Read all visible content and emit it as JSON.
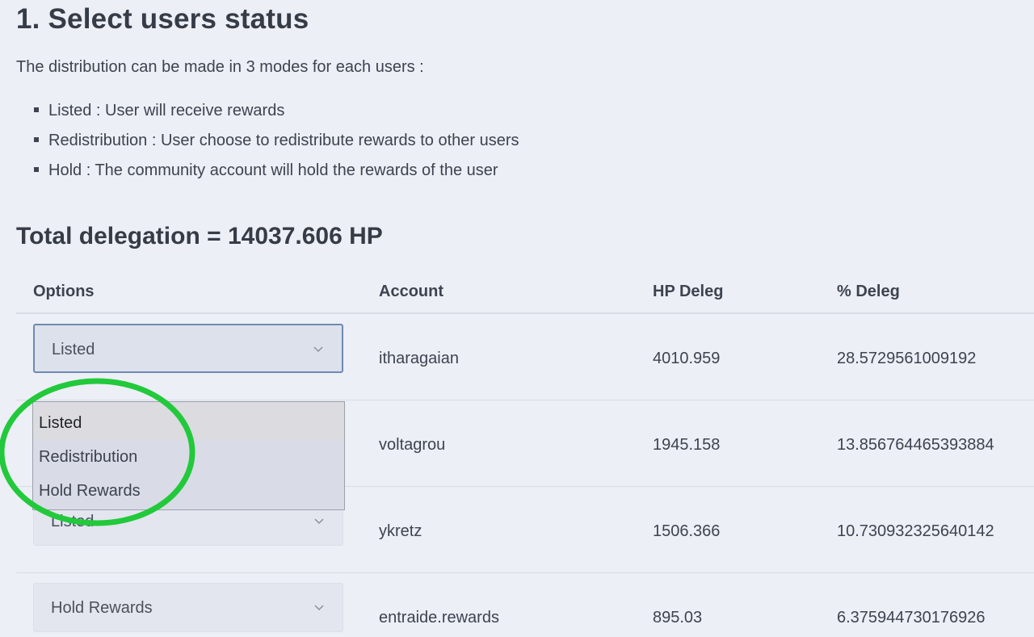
{
  "heading": "1. Select users status",
  "intro": "The distribution can be made in 3 modes for each users :",
  "modes": [
    "Listed : User will receive rewards",
    "Redistribution : User choose to redistribute rewards to other users",
    "Hold : The community account will hold the rewards of the user"
  ],
  "total": "Total delegation = 14037.606 HP",
  "table": {
    "headers": {
      "options": "Options",
      "account": "Account",
      "hp": "HP Deleg",
      "pct": "% Deleg"
    },
    "rows": [
      {
        "option": "Listed",
        "account": "itharagaian",
        "hp": "4010.959",
        "pct": "28.5729561009192"
      },
      {
        "option": "",
        "account": "voltagrou",
        "hp": "1945.158",
        "pct": "13.856764465393884"
      },
      {
        "option": "Listed",
        "account": "ykretz",
        "hp": "1506.366",
        "pct": "10.730932325640142"
      },
      {
        "option": "Hold Rewards",
        "account": "entraide.rewards",
        "hp": "895.03",
        "pct": "6.375944730176926"
      }
    ]
  },
  "dropdown": {
    "options": [
      "Listed",
      "Redistribution",
      "Hold Rewards"
    ]
  },
  "colors": {
    "background": "#eceff5",
    "annotation_circle": "#22c93b",
    "focus_border": "#6f8ab0"
  }
}
